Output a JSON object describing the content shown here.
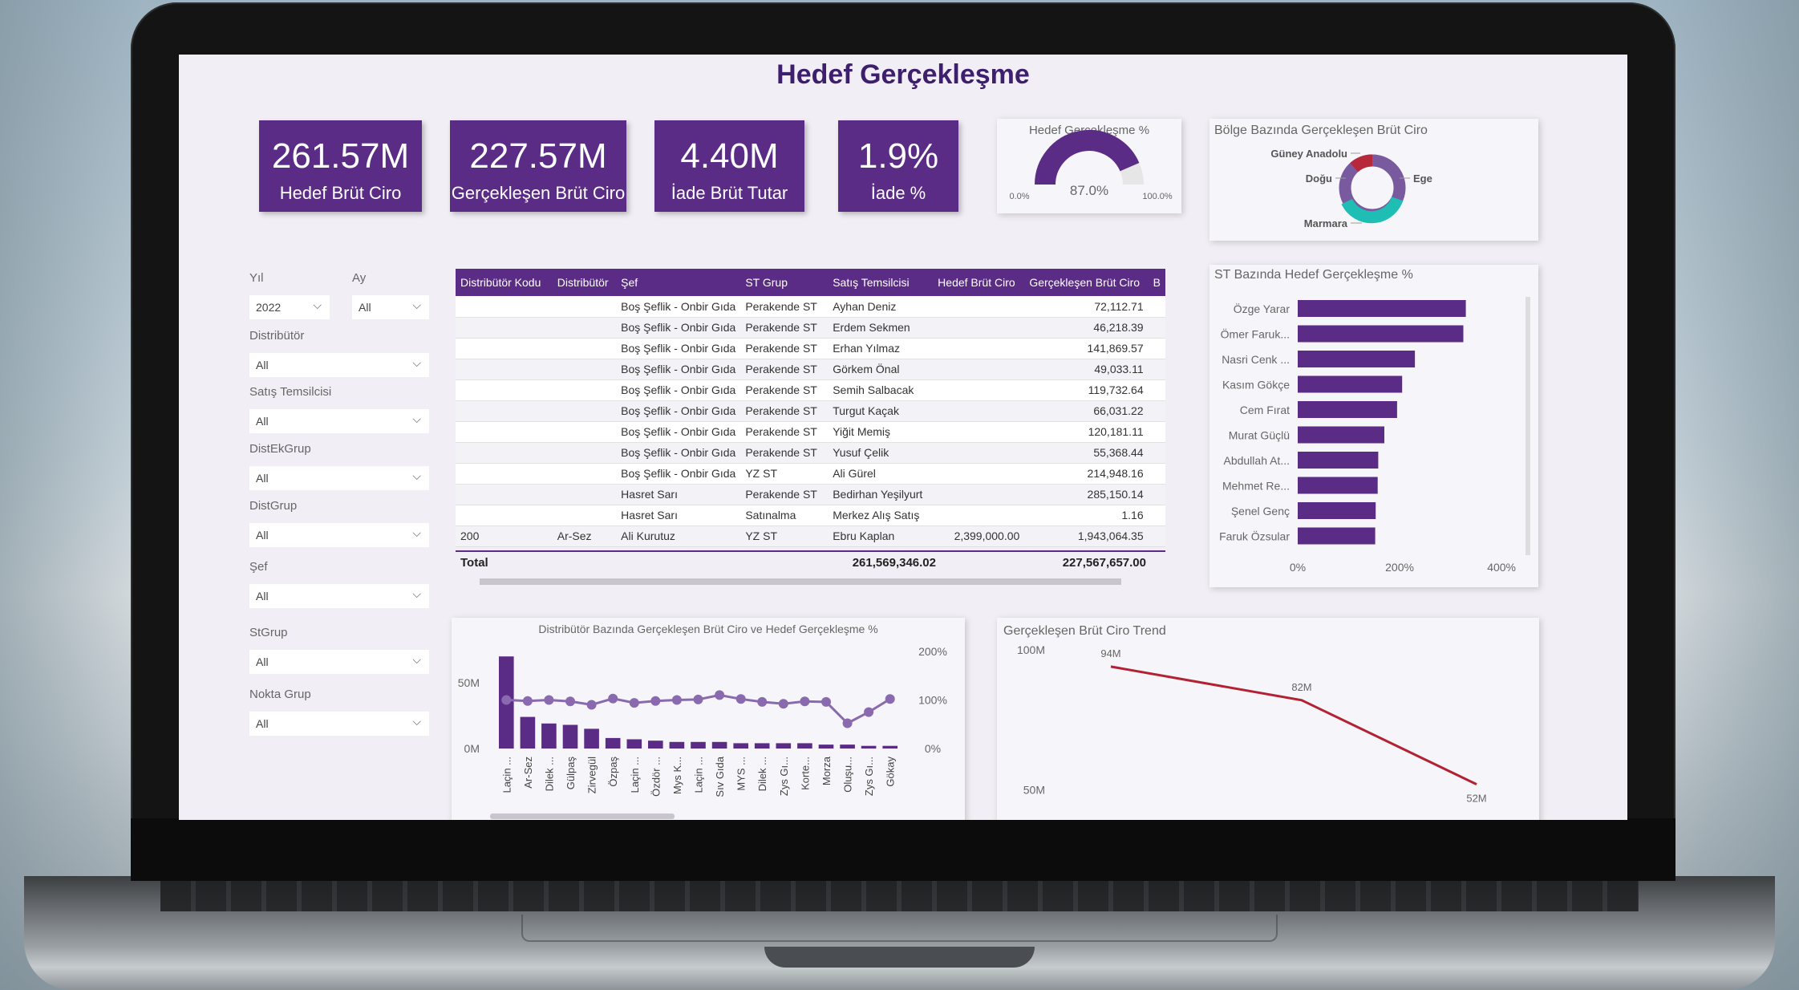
{
  "page": {
    "title": "Hedef Gerçekleşme"
  },
  "kpis": [
    {
      "value": "261.57M",
      "label": "Hedef Brüt Ciro"
    },
    {
      "value": "227.57M",
      "label": "Gerçekleşen Brüt Ciro"
    },
    {
      "value": "4.40M",
      "label": "İade Brüt Tutar"
    },
    {
      "value": "1.9%",
      "label": "İade %"
    }
  ],
  "gauge": {
    "title": "Hedef Gerçekleşme %",
    "min_label": "0.0%",
    "max_label": "100.0%",
    "value_label": "87.0%",
    "value": 0.87,
    "fill_color": "#5b2c86",
    "track_color": "#e6e6e6"
  },
  "donut": {
    "title": "Bölge Bazında Gerçekleşen Brüt Ciro",
    "labels": [
      "Güney Anadolu",
      "Doğu",
      "Ege",
      "Marmara"
    ],
    "colors": {
      "Güney Anadolu": "#b6283a",
      "Doğu": "#7a5a9f",
      "Ege": "#7a5a9f",
      "Marmara": "#1fbeb4"
    }
  },
  "slicers": {
    "yil": {
      "label": "Yıl",
      "value": "2022"
    },
    "ay": {
      "label": "Ay",
      "value": "All"
    },
    "distributor": {
      "label": "Distribütör",
      "value": "All"
    },
    "satis_temsilcisi": {
      "label": "Satış Temsilcisi",
      "value": "All"
    },
    "distekgrup": {
      "label": "DistEkGrup",
      "value": "All"
    },
    "distgrup": {
      "label": "DistGrup",
      "value": "All"
    },
    "sef": {
      "label": "Şef",
      "value": "All"
    },
    "stgrup": {
      "label": "StGrup",
      "value": "All"
    },
    "nokta_grup": {
      "label": "Nokta Grup",
      "value": "All"
    }
  },
  "table": {
    "headers": [
      "Distribütör Kodu",
      "Distribütör",
      "Şef",
      "ST Grup",
      "Satış Temsilcisi",
      "Hedef Brüt Ciro",
      "Gerçekleşen Brüt Ciro",
      "B"
    ],
    "rows": [
      [
        "",
        "",
        "Boş Şeflik - Onbir Gıda",
        "Perakende ST",
        "Ayhan Deniz",
        "",
        "72,112.71"
      ],
      [
        "",
        "",
        "Boş Şeflik - Onbir Gıda",
        "Perakende ST",
        "Erdem Sekmen",
        "",
        "46,218.39"
      ],
      [
        "",
        "",
        "Boş Şeflik - Onbir Gıda",
        "Perakende ST",
        "Erhan Yılmaz",
        "",
        "141,869.57"
      ],
      [
        "",
        "",
        "Boş Şeflik - Onbir Gıda",
        "Perakende ST",
        "Görkem Önal",
        "",
        "49,033.11"
      ],
      [
        "",
        "",
        "Boş Şeflik - Onbir Gıda",
        "Perakende ST",
        "Semih Salbacak",
        "",
        "119,732.64"
      ],
      [
        "",
        "",
        "Boş Şeflik - Onbir Gıda",
        "Perakende ST",
        "Turgut Kaçak",
        "",
        "66,031.22"
      ],
      [
        "",
        "",
        "Boş Şeflik - Onbir Gıda",
        "Perakende ST",
        "Yiğit Memiş",
        "",
        "120,181.11"
      ],
      [
        "",
        "",
        "Boş Şeflik - Onbir Gıda",
        "Perakende ST",
        "Yusuf Çelik",
        "",
        "55,368.44"
      ],
      [
        "",
        "",
        "Boş Şeflik - Onbir Gıda",
        "YZ ST",
        "Ali Gürel",
        "",
        "214,948.16"
      ],
      [
        "",
        "",
        "Hasret Sarı",
        "Perakende ST",
        "Bedirhan Yeşilyurt",
        "",
        "285,150.14"
      ],
      [
        "",
        "",
        "Hasret Sarı",
        "Satınalma",
        "Merkez Alış Satış",
        "",
        "1.16"
      ],
      [
        "200",
        "Ar-Sez",
        "Ali Kurutuz",
        "YZ ST",
        "Ebru Kaplan",
        "2,399,000.00",
        "1,943,064.35"
      ]
    ],
    "total": {
      "label": "Total",
      "hedef": "261,569,346.02",
      "gerceklesen": "227,567,657.00"
    }
  },
  "st_bar": {
    "title": "ST Bazında Hedef Gerçekleşme %",
    "categories": [
      "Özge Yarar",
      "Ömer Faruk...",
      "Nasri Cenk ...",
      "Kasım Gökçe",
      "Cem Fırat",
      "Murat Güçlü",
      "Abdullah At...",
      "Mehmet Re...",
      "Şenel Genç",
      "Faruk Özsular"
    ],
    "values": [
      330,
      325,
      230,
      205,
      195,
      170,
      158,
      157,
      153,
      152
    ],
    "xticks": [
      "0%",
      "200%",
      "400%"
    ],
    "xlim": [
      0,
      425
    ],
    "color": "#5b2c86"
  },
  "combo": {
    "title": "Distribütör Bazında Gerçekleşen Brüt Ciro ve Hedef Gerçekleşme %",
    "categories": [
      "Laçin ...",
      "Ar-Sez",
      "Dilek ...",
      "Gülpaş",
      "Zirvegül",
      "Özpaş",
      "Laçin ...",
      "Özdör ...",
      "Mys K...",
      "Laçin ...",
      "Sıv Gıda",
      "MYS ...",
      "Dilek ...",
      "Zys Gı...",
      "Korte...",
      "Morza",
      "Oluşu...",
      "Zys Gı...",
      "Gökay"
    ],
    "bar_values": [
      70,
      24,
      19,
      18,
      15,
      8,
      7,
      6,
      5,
      5,
      5,
      4,
      4,
      4,
      4,
      3,
      3,
      2,
      2
    ],
    "line_values": [
      100,
      98,
      100,
      97,
      90,
      103,
      94,
      98,
      100,
      101,
      110,
      102,
      96,
      92,
      97,
      96,
      52,
      75,
      102
    ],
    "left_ticks": [
      "0M",
      "50M"
    ],
    "right_ticks": [
      "0%",
      "100%",
      "200%"
    ],
    "left_lim": [
      0,
      75
    ],
    "right_lim": [
      0,
      200
    ],
    "color": "#5b2c86"
  },
  "trend": {
    "title": "Gerçekleşen Brüt Ciro Trend",
    "values": [
      94,
      82,
      52
    ],
    "point_labels": [
      "94M",
      "82M",
      "52M"
    ],
    "y_ticks": [
      "50M",
      "100M"
    ],
    "ylim": [
      45,
      100
    ],
    "color": "#b22233"
  }
}
